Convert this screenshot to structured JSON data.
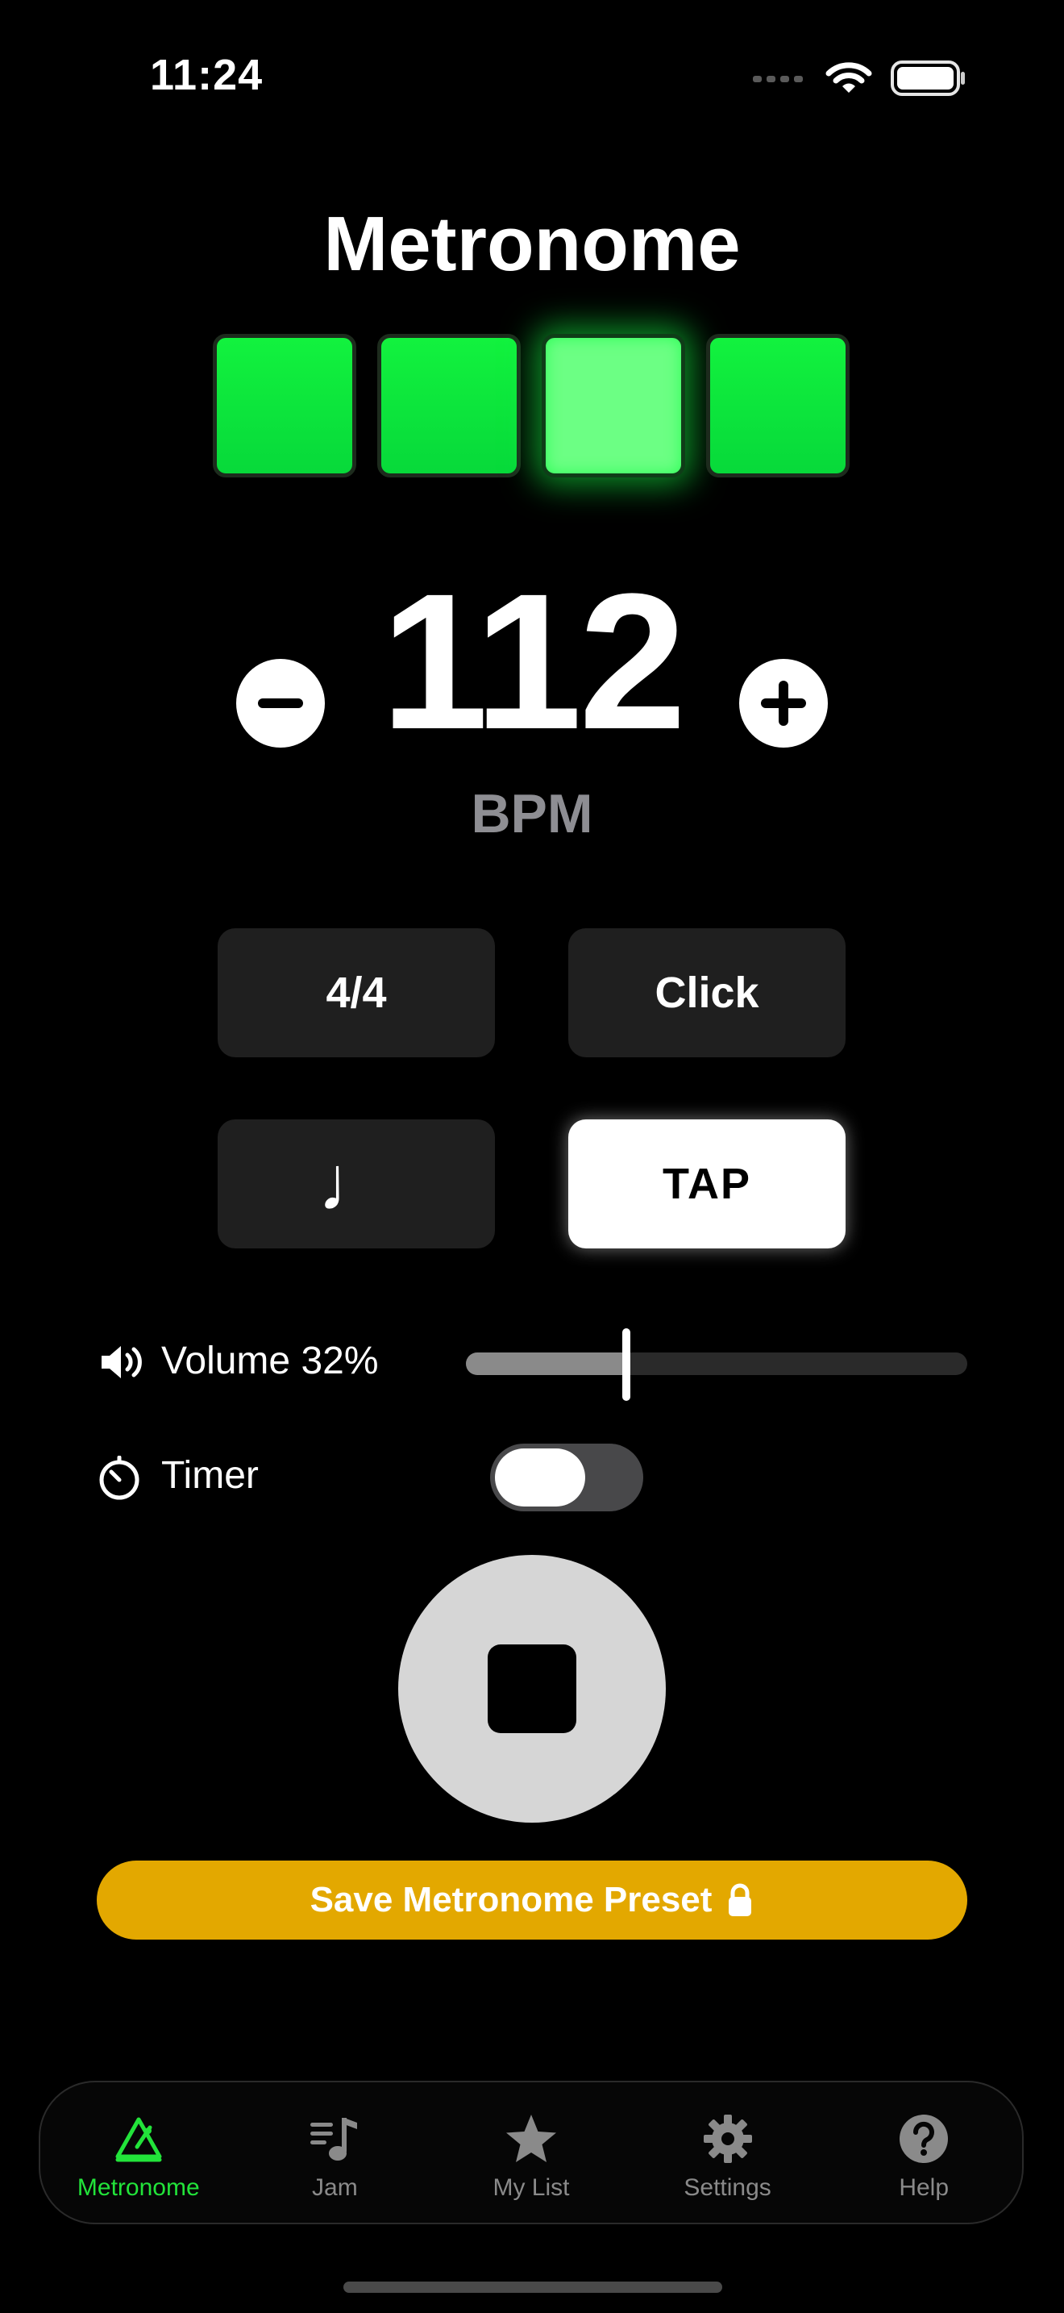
{
  "status_bar": {
    "time": "11:24"
  },
  "title": "Metronome",
  "beats": {
    "count": 4,
    "active_index": 2,
    "color": "#0ff03c",
    "active_color": "#6cff84"
  },
  "tempo": {
    "value": "112",
    "unit": "BPM"
  },
  "options": {
    "time_signature": "4/4",
    "sound": "Click",
    "subdivision_symbol": "♩",
    "tap_label": "TAP"
  },
  "volume": {
    "label": "Volume 32%",
    "level_percent": 32
  },
  "timer": {
    "label": "Timer",
    "enabled": false
  },
  "save_preset": {
    "label": "Save Metronome Preset",
    "icon": "lock-icon",
    "color": "#e3a800"
  },
  "tabs": [
    {
      "label": "Metronome",
      "icon": "metronome-icon",
      "active": true
    },
    {
      "label": "Jam",
      "icon": "music-list-icon",
      "active": false
    },
    {
      "label": "My List",
      "icon": "star-icon",
      "active": false
    },
    {
      "label": "Settings",
      "icon": "gear-icon",
      "active": false
    },
    {
      "label": "Help",
      "icon": "help-icon",
      "active": false
    }
  ],
  "colors": {
    "accent_green": "#22e33a",
    "background": "#000000"
  }
}
